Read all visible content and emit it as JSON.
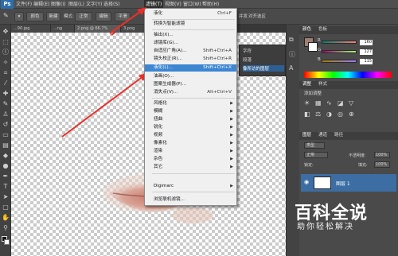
{
  "menubar": {
    "logo": "Ps",
    "items": [
      "文件(F)",
      "编辑(E)",
      "图像(I)",
      "图层(L)",
      "文字(Y)",
      "选择(S)",
      "滤镜(T)",
      "视图(V)",
      "窗口(W)",
      "帮助(H)"
    ]
  },
  "options": {
    "style_label": "颜色",
    "mode_label": "模式:",
    "mode_value": "正常",
    "button_new": "新建",
    "button_edit": "编辑",
    "button_smooth": "平滑",
    "button_right": "对齐选区",
    "label_end": "并发",
    "status_label": "状态"
  },
  "tabs": [
    "...90.jpg",
    "...ng",
    "2.png @ 66.7%",
    "3.png",
    "..."
  ],
  "canvas": {
    "image_description": "lips"
  },
  "filter_menu": {
    "items": [
      {
        "label": "液化",
        "shortcut": "Ctrl+F",
        "arrow": ""
      },
      {
        "label": "转换为智能滤镜",
        "shortcut": "",
        "arrow": ""
      },
      {
        "label": "抽出(X)...",
        "shortcut": "",
        "arrow": ""
      },
      {
        "label": "滤镜库(G)...",
        "shortcut": "",
        "arrow": ""
      },
      {
        "label": "自适应广角(A)...",
        "shortcut": "Shift+Ctrl+A",
        "arrow": ""
      },
      {
        "label": "镜头校正(R)...",
        "shortcut": "Shift+Ctrl+R",
        "arrow": ""
      },
      {
        "label": "液化(L)...",
        "shortcut": "Shift+Ctrl+X",
        "arrow": ""
      },
      {
        "label": "油画(O)...",
        "shortcut": "",
        "arrow": ""
      },
      {
        "label": "图案生成器(P)...",
        "shortcut": "",
        "arrow": ""
      },
      {
        "label": "消失点(V)...",
        "shortcut": "Alt+Ctrl+V",
        "arrow": ""
      },
      {
        "label": "风格化",
        "shortcut": "",
        "arrow": "▶"
      },
      {
        "label": "模糊",
        "shortcut": "",
        "arrow": "▶"
      },
      {
        "label": "扭曲",
        "shortcut": "",
        "arrow": "▶"
      },
      {
        "label": "锐化",
        "shortcut": "",
        "arrow": "▶"
      },
      {
        "label": "视频",
        "shortcut": "",
        "arrow": "▶"
      },
      {
        "label": "像素化",
        "shortcut": "",
        "arrow": "▶"
      },
      {
        "label": "渲染",
        "shortcut": "",
        "arrow": "▶"
      },
      {
        "label": "杂色",
        "shortcut": "",
        "arrow": "▶"
      },
      {
        "label": "其它",
        "shortcut": "",
        "arrow": "▶"
      },
      {
        "label": "Digimarc",
        "shortcut": "",
        "arrow": "▶"
      },
      {
        "label": "浏览联机滤镜...",
        "shortcut": "",
        "arrow": ""
      }
    ]
  },
  "color_panel": {
    "tabs": [
      "颜色",
      "色板"
    ],
    "r": "160",
    "g": "127",
    "b": "115",
    "r_label": "R",
    "g_label": "G",
    "b_label": "B",
    "fg_color": "#a07f73"
  },
  "adjust_panel": {
    "tabs": [
      "调整",
      "样式"
    ],
    "add_label": "添加调整"
  },
  "layers_panel": {
    "tabs": [
      "图层",
      "通道",
      "路径"
    ],
    "kind_label": "类型",
    "blend_mode": "正常",
    "opacity_label": "不透明度:",
    "opacity_value": "100%",
    "lock_label": "锁定:",
    "fill_label": "填充:",
    "fill_value": "100%",
    "layer_name": "图层 1"
  },
  "mini_panel": {
    "items": [
      "字符",
      "段落",
      "像所访的图层"
    ]
  },
  "watermark": {
    "title": "百科全说",
    "subtitle": "助你轻松解决"
  },
  "colors": {
    "menu_highlight": "#3c86d2",
    "arrow": "#e8312a",
    "app_bg": "#535353"
  }
}
